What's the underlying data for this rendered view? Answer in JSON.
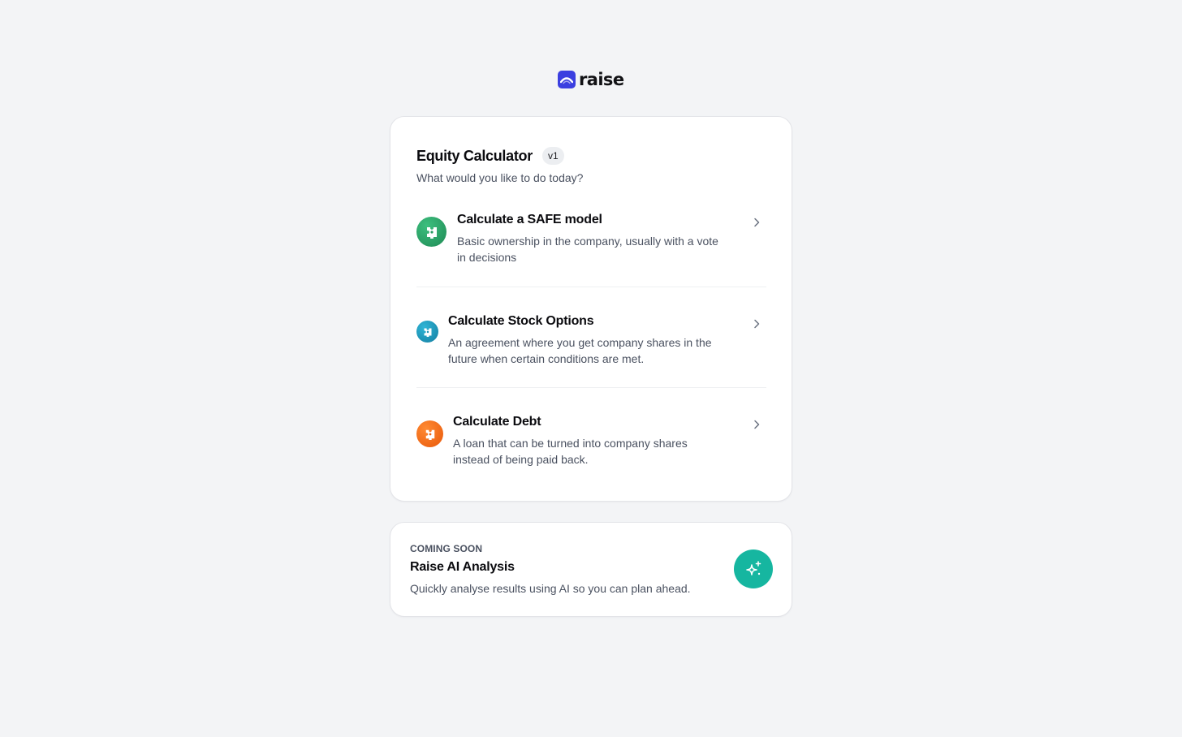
{
  "brand": {
    "name": "raise",
    "logo_icon": "raise-logo-icon",
    "accent": "#3b3fe0"
  },
  "calculator": {
    "title": "Equity Calculator",
    "version": "v1",
    "subtitle": "What would you like to do today?",
    "options": [
      {
        "title": "Calculate a SAFE model",
        "description": "Basic ownership in the company, usually with a vote in decisions",
        "icon": "puzzle-piece-icon",
        "color": "#2ea86b"
      },
      {
        "title": "Calculate Stock Options",
        "description": "An agreement where you get company shares in the future when certain conditions are met.",
        "icon": "puzzle-piece-icon",
        "color": "#1f9cc0"
      },
      {
        "title": "Calculate Debt",
        "description": "A loan that can be turned into company shares instead of being paid back.",
        "icon": "puzzle-piece-icon",
        "color": "#f36d1a"
      }
    ]
  },
  "coming_soon": {
    "eyebrow": "COMING SOON",
    "title": "Raise AI Analysis",
    "description": "Quickly analyse results using AI so you can plan ahead.",
    "icon": "sparkles-icon",
    "color": "#16b6a0"
  }
}
